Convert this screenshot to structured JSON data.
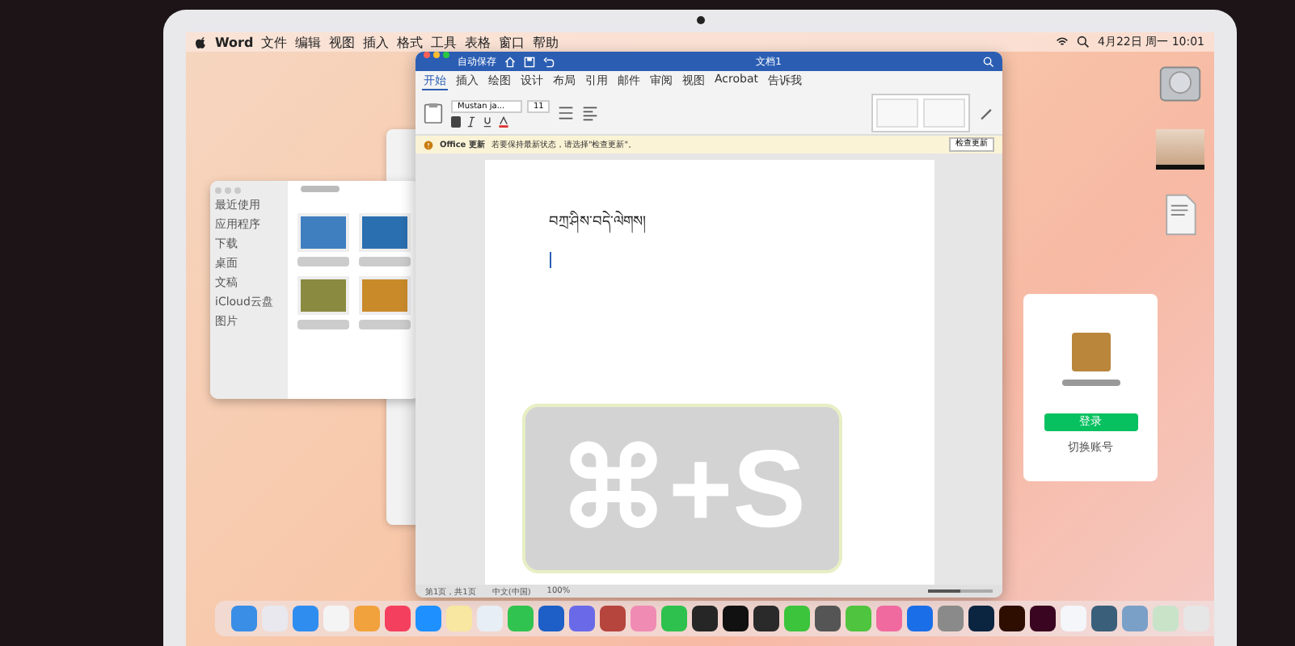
{
  "menu_bar": {
    "app": "Word",
    "items": [
      "文件",
      "编辑",
      "视图",
      "插入",
      "格式",
      "工具",
      "表格",
      "窗口",
      "帮助"
    ],
    "clock": "4月22日 周一 10:01"
  },
  "finder": {
    "sidebar": [
      "最近使用",
      "应用程序",
      "下载",
      "桌面",
      "文稿",
      "iCloud云盘",
      "图片"
    ],
    "files": [
      {
        "color": "#3f7fc0"
      },
      {
        "color": "#2a6fb0"
      },
      {
        "color": "#8a8a40"
      },
      {
        "color": "#c98a2a"
      }
    ]
  },
  "word": {
    "title": "文档1",
    "autosave": "自动保存",
    "tabs": [
      {
        "label": "开始",
        "selected": true
      },
      {
        "label": "插入",
        "selected": false
      },
      {
        "label": "绘图",
        "selected": false
      },
      {
        "label": "设计",
        "selected": false
      },
      {
        "label": "布局",
        "selected": false
      },
      {
        "label": "引用",
        "selected": false
      },
      {
        "label": "邮件",
        "selected": false
      },
      {
        "label": "审阅",
        "selected": false
      },
      {
        "label": "视图",
        "selected": false
      },
      {
        "label": "Acrobat",
        "selected": false
      },
      {
        "label": "告诉我",
        "selected": false
      }
    ],
    "font": "Mustan ja...",
    "size": "11",
    "banner": {
      "title": "Office 更新",
      "message": "若要保持最新状态，请选择\"检查更新\"。",
      "button": "检查更新"
    },
    "document_text": "བཀྲ་ཤིས་བདེ་ལེགས།",
    "status": [
      "第1页，共1页",
      "中文(中国)",
      "100%"
    ],
    "zoom": {
      "level": 0.5
    }
  },
  "shortcut": "⌘+S",
  "login_card": {
    "button": "登录",
    "link": "切换账号"
  },
  "dock": [
    {
      "color": "#3a8ee6"
    },
    {
      "color": "#e8e8ee"
    },
    {
      "color": "#2f8df0"
    },
    {
      "color": "#f4f4f4"
    },
    {
      "color": "#f2a23c"
    },
    {
      "color": "#f43f5e"
    },
    {
      "color": "#1e90ff"
    },
    {
      "color": "#f7e7a0"
    },
    {
      "color": "#e8eef5"
    },
    {
      "color": "#31c34f"
    },
    {
      "color": "#1d5fc6"
    },
    {
      "color": "#6a6ae8"
    },
    {
      "color": "#b6453e"
    },
    {
      "color": "#f08bb4"
    },
    {
      "color": "#2ec14d"
    },
    {
      "color": "#262626"
    },
    {
      "color": "#111111"
    },
    {
      "color": "#2a2a2a"
    },
    {
      "color": "#3cc43c"
    },
    {
      "color": "#555555"
    },
    {
      "color": "#4fc43f"
    },
    {
      "color": "#f06aa0"
    },
    {
      "color": "#1a6fe8"
    },
    {
      "color": "#8a8a8a"
    },
    {
      "color": "#0b2440"
    },
    {
      "color": "#2e0e00"
    },
    {
      "color": "#3a0520"
    },
    {
      "color": "#f4f6fa"
    },
    {
      "color": "#3a5f7a"
    },
    {
      "color": "#7aa0c8"
    },
    {
      "color": "#c9e3c9"
    },
    {
      "color": "#e6e6e6"
    }
  ]
}
